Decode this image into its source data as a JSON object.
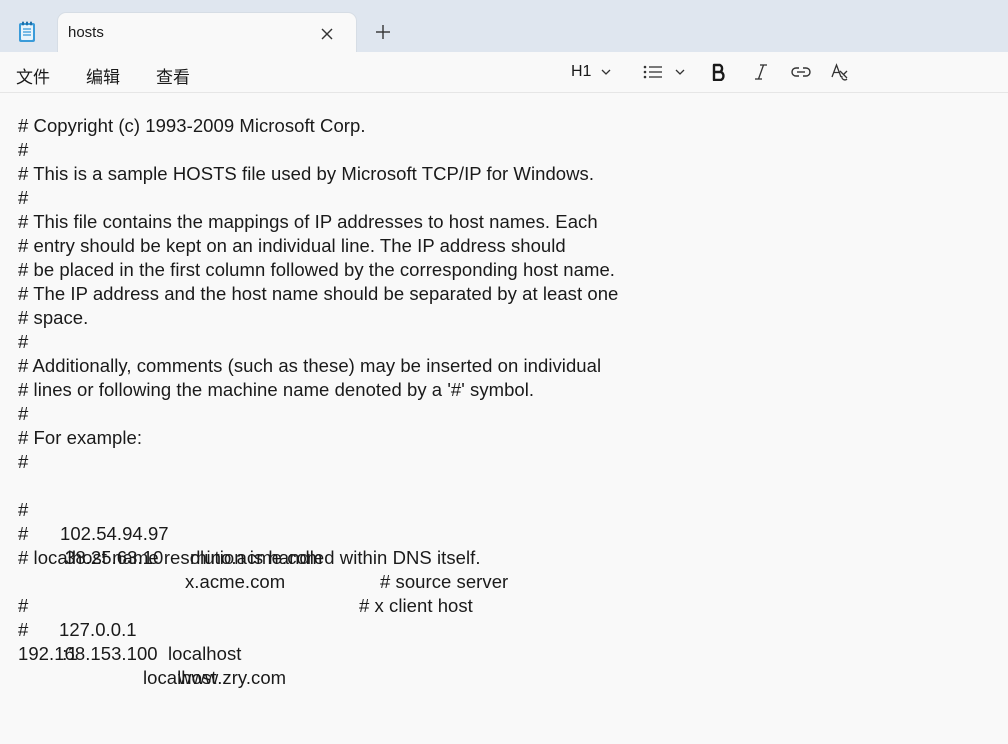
{
  "tab": {
    "title": "hosts",
    "close_icon": "close-icon",
    "new_tab_icon": "plus-icon"
  },
  "menu": {
    "file": "文件",
    "edit": "编辑",
    "view": "查看"
  },
  "toolbar": {
    "heading_label": "H1",
    "heading_icon": "chevron-down-icon",
    "list_icon": "bulleted-list-icon",
    "bold_icon": "bold-icon",
    "italic_icon": "italic-icon",
    "link_icon": "link-icon",
    "clear_format_icon": "clear-formatting-icon"
  },
  "document": {
    "lines": {
      "l1": "# Copyright (c) 1993-2009 Microsoft Corp.",
      "l2": "#",
      "l3": "# This is a sample HOSTS file used by Microsoft TCP/IP for Windows.",
      "l4": "#",
      "l5": "# This file contains the mappings of IP addresses to host names. Each",
      "l6": "# entry should be kept on an individual line. The IP address should",
      "l7": "# be placed in the first column followed by the corresponding host name.",
      "l8": "# The IP address and the host name should be separated by at least one",
      "l9": "# space.",
      "l10": "#",
      "l11": "# Additionally, comments (such as these) may be inserted on individual",
      "l12": "# lines or following the machine name denoted by a '#' symbol.",
      "l13": "#",
      "l14": "# For example:",
      "l15": "#",
      "l19": "# localhost name resolution is handled within DNS itself."
    },
    "example1": {
      "hash": "#",
      "ip": "102.54.94.97",
      "host": "rhino.acme.com",
      "comment": "# source server"
    },
    "example2": {
      "hash": "#",
      "ip": "38.25.63.10",
      "host": "x.acme.com",
      "comment": "# x client host"
    },
    "local1": {
      "hash": "#",
      "ip": "127.0.0.1",
      "host": "localhost"
    },
    "local2": {
      "hash": "#",
      "ip": "::1",
      "host": "localhost"
    },
    "entry": {
      "ip": "192.168.153.100",
      "host": "www.zry.com"
    }
  }
}
